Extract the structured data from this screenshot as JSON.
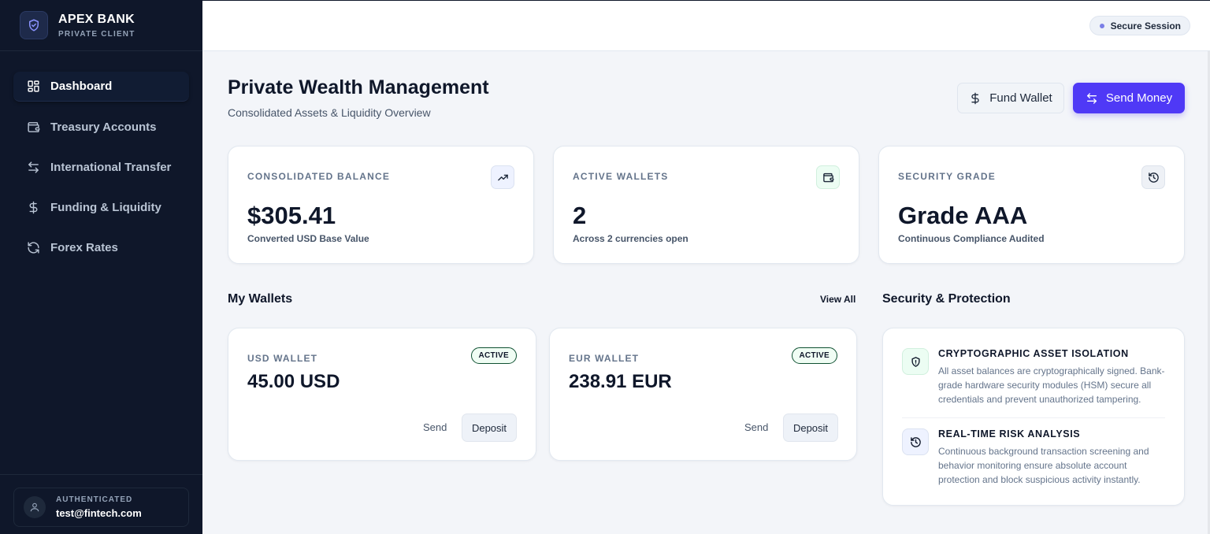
{
  "brand": {
    "name": "APEX BANK",
    "tagline": "PRIVATE CLIENT"
  },
  "nav": [
    {
      "label": "Dashboard",
      "icon": "grid-icon",
      "active": true
    },
    {
      "label": "Treasury Accounts",
      "icon": "wallet-icon"
    },
    {
      "label": "International Transfer",
      "icon": "transfer-arrows-icon"
    },
    {
      "label": "Funding & Liquidity",
      "icon": "dollar-icon"
    },
    {
      "label": "Forex Rates",
      "icon": "refresh-icon"
    }
  ],
  "user": {
    "label": "AUTHENTICATED",
    "email": "test@fintech.com"
  },
  "topbar": {
    "session": "Secure Session"
  },
  "header": {
    "title": "Private Wealth Management",
    "subtitle": "Consolidated Assets & Liquidity Overview",
    "fund_label": "Fund Wallet",
    "send_label": "Send Money"
  },
  "stats": [
    {
      "label": "CONSOLIDATED BALANCE",
      "value": "$305.41",
      "desc": "Converted USD Base Value",
      "icon": "trending-up-icon"
    },
    {
      "label": "ACTIVE WALLETS",
      "value": "2",
      "desc": "Across 2 currencies open",
      "icon": "wallet-icon"
    },
    {
      "label": "SECURITY GRADE",
      "value": "Grade AAA",
      "desc": "Continuous Compliance Audited",
      "icon": "history-icon"
    }
  ],
  "wallets_section": {
    "title": "My Wallets",
    "view_all": "View All"
  },
  "wallets": [
    {
      "name": "USD WALLET",
      "amount": "45.00 USD",
      "status": "ACTIVE",
      "send": "Send",
      "deposit": "Deposit"
    },
    {
      "name": "EUR WALLET",
      "amount": "238.91 EUR",
      "status": "ACTIVE",
      "send": "Send",
      "deposit": "Deposit"
    }
  ],
  "security": {
    "title": "Security & Protection",
    "items": [
      {
        "title": "CRYPTOGRAPHIC ASSET ISOLATION",
        "desc": "All asset balances are cryptographically signed. Bank-grade hardware security modules (HSM) secure all credentials and prevent unauthorized tampering.",
        "icon": "shield-icon"
      },
      {
        "title": "REAL-TIME RISK ANALYSIS",
        "desc": "Continuous background transaction screening and behavior monitoring ensure absolute account protection and block suspicious activity instantly.",
        "icon": "history-icon"
      }
    ]
  },
  "colors": {
    "sidebar": "#0f172a",
    "accent": "#4f39f6",
    "background": "#f3f5f9"
  }
}
